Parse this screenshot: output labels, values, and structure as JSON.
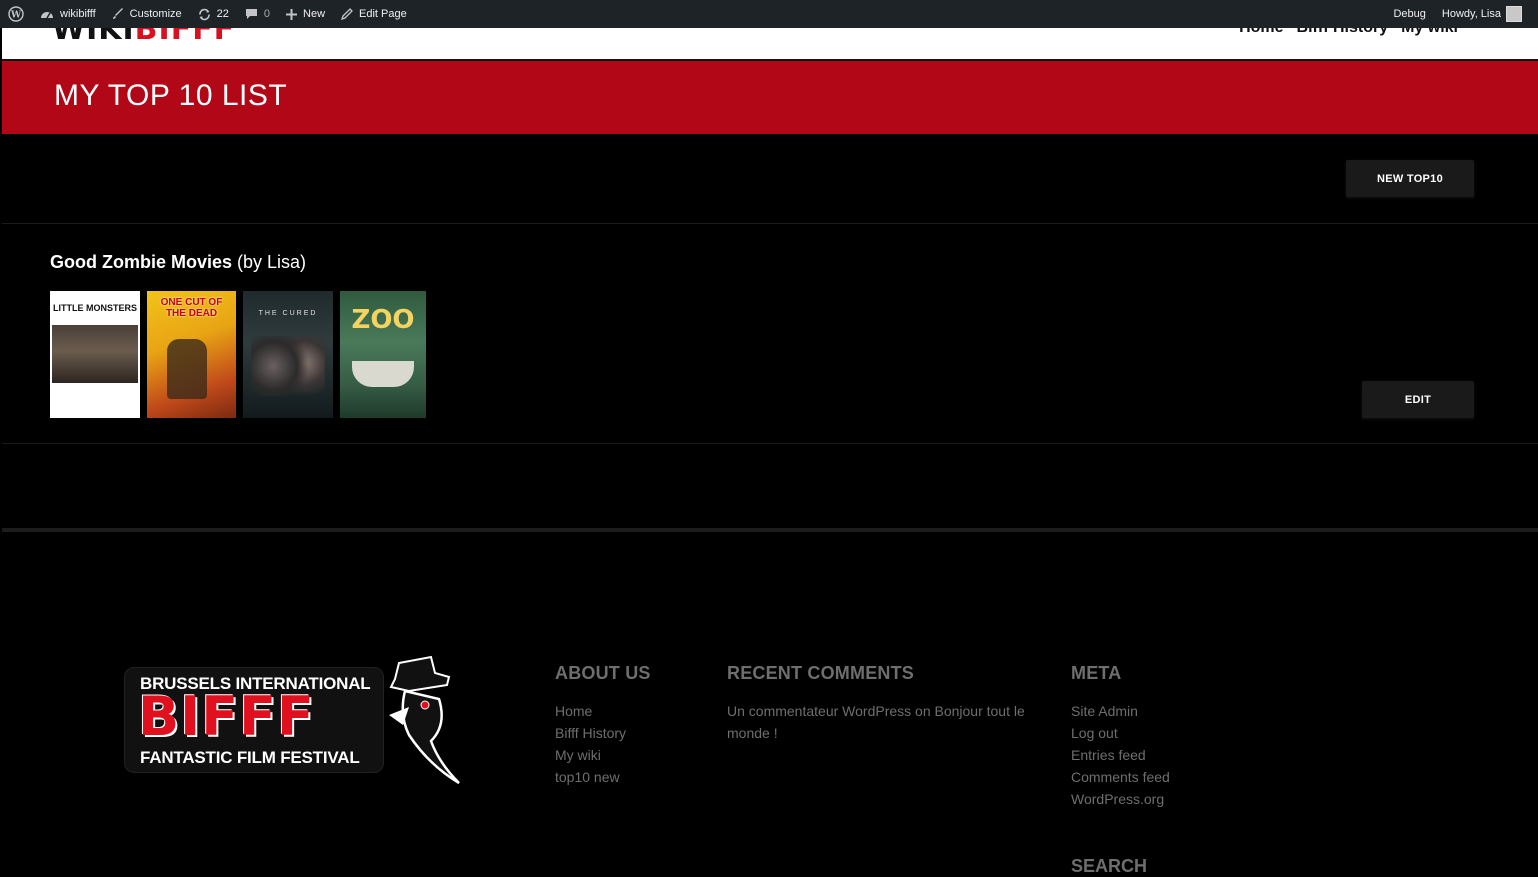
{
  "admin_bar": {
    "site_name": "wikibifff",
    "customize": "Customize",
    "updates_count": "22",
    "comments_count": "0",
    "new_label": "New",
    "edit_page": "Edit Page",
    "debug": "Debug",
    "howdy": "Howdy, Lisa"
  },
  "header": {
    "logo_part1": "WIKI",
    "logo_part2": "BIFFF",
    "nav": [
      "Home",
      "Bifff History",
      "My wiki"
    ]
  },
  "page_title": "MY TOP 10 LIST",
  "new_button": "NEW TOP10",
  "list": {
    "name": "Good Zombie Movies",
    "author": "(by Lisa)",
    "posters": [
      {
        "title": "LITTLE MONSTERS"
      },
      {
        "title": "ONE CUT OF THE DEAD"
      },
      {
        "title": "THE CURED"
      },
      {
        "title": "ZOO"
      }
    ],
    "edit_button": "EDIT"
  },
  "footer": {
    "logo_top": "BRUSSELS INTERNATIONAL",
    "logo_mid": "BIFFF",
    "logo_bottom": "FANTASTIC FILM FESTIVAL",
    "about": {
      "heading": "ABOUT US",
      "links": [
        "Home",
        "Bifff History",
        "My wiki",
        "top10 new"
      ]
    },
    "recent": {
      "heading": "RECENT COMMENTS",
      "text": "Un commentateur WordPress on Bonjour tout le monde !"
    },
    "meta": {
      "heading": "META",
      "links": [
        "Site Admin",
        "Log out",
        "Entries feed",
        "Comments feed",
        "WordPress.org"
      ]
    },
    "search_heading": "SEARCH"
  },
  "colors": {
    "accent_red": "#b10717",
    "admin_bar": "#1d2327"
  }
}
